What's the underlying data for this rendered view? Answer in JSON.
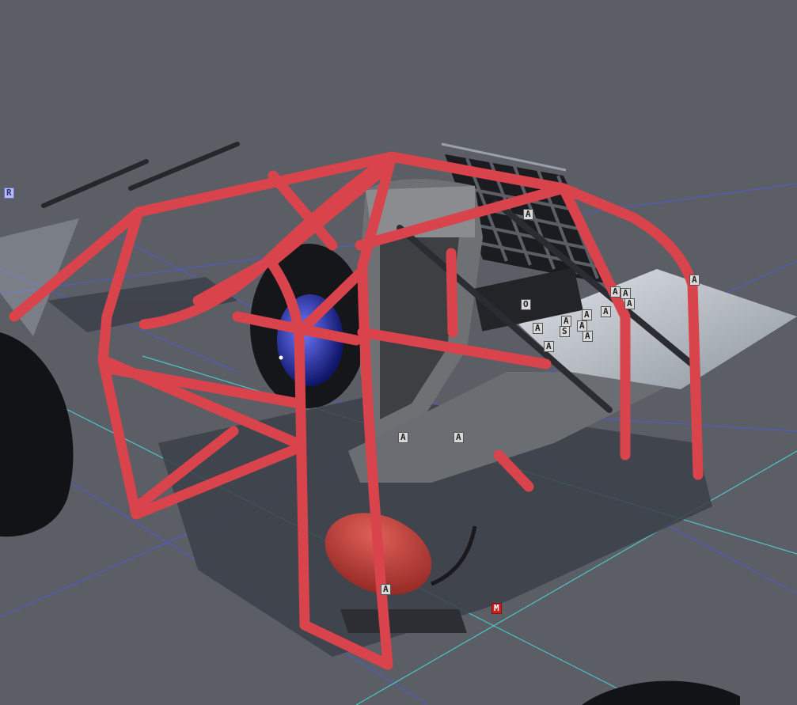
{
  "viewport": {
    "background": "#5b5e65",
    "grid_colors": {
      "primary": "#4e5ae0",
      "secondary": "#49d6d6"
    },
    "rollcage_color": "#d9434b",
    "seat_color": "#6f7074",
    "extinguisher_color": "#c33a36",
    "wheel_color": "#121316",
    "blue_part_color": "#2230b8"
  },
  "markers": [
    {
      "label": "R",
      "kind": "blue"
    },
    {
      "label": "A",
      "kind": "gray"
    },
    {
      "label": "A",
      "kind": "gray"
    },
    {
      "label": "O",
      "kind": "gray"
    },
    {
      "label": "A",
      "kind": "gray"
    },
    {
      "label": "A",
      "kind": "gray"
    },
    {
      "label": "A",
      "kind": "gray"
    },
    {
      "label": "A",
      "kind": "gray"
    },
    {
      "label": "A",
      "kind": "gray"
    },
    {
      "label": "A",
      "kind": "gray"
    },
    {
      "label": "A",
      "kind": "gray"
    },
    {
      "label": "S",
      "kind": "gray"
    },
    {
      "label": "A",
      "kind": "gray"
    },
    {
      "label": "A",
      "kind": "gray"
    },
    {
      "label": "A",
      "kind": "gray"
    },
    {
      "label": "A",
      "kind": "gray"
    },
    {
      "label": "A",
      "kind": "gray"
    },
    {
      "label": "A",
      "kind": "gray"
    },
    {
      "label": "M",
      "kind": "red"
    }
  ]
}
